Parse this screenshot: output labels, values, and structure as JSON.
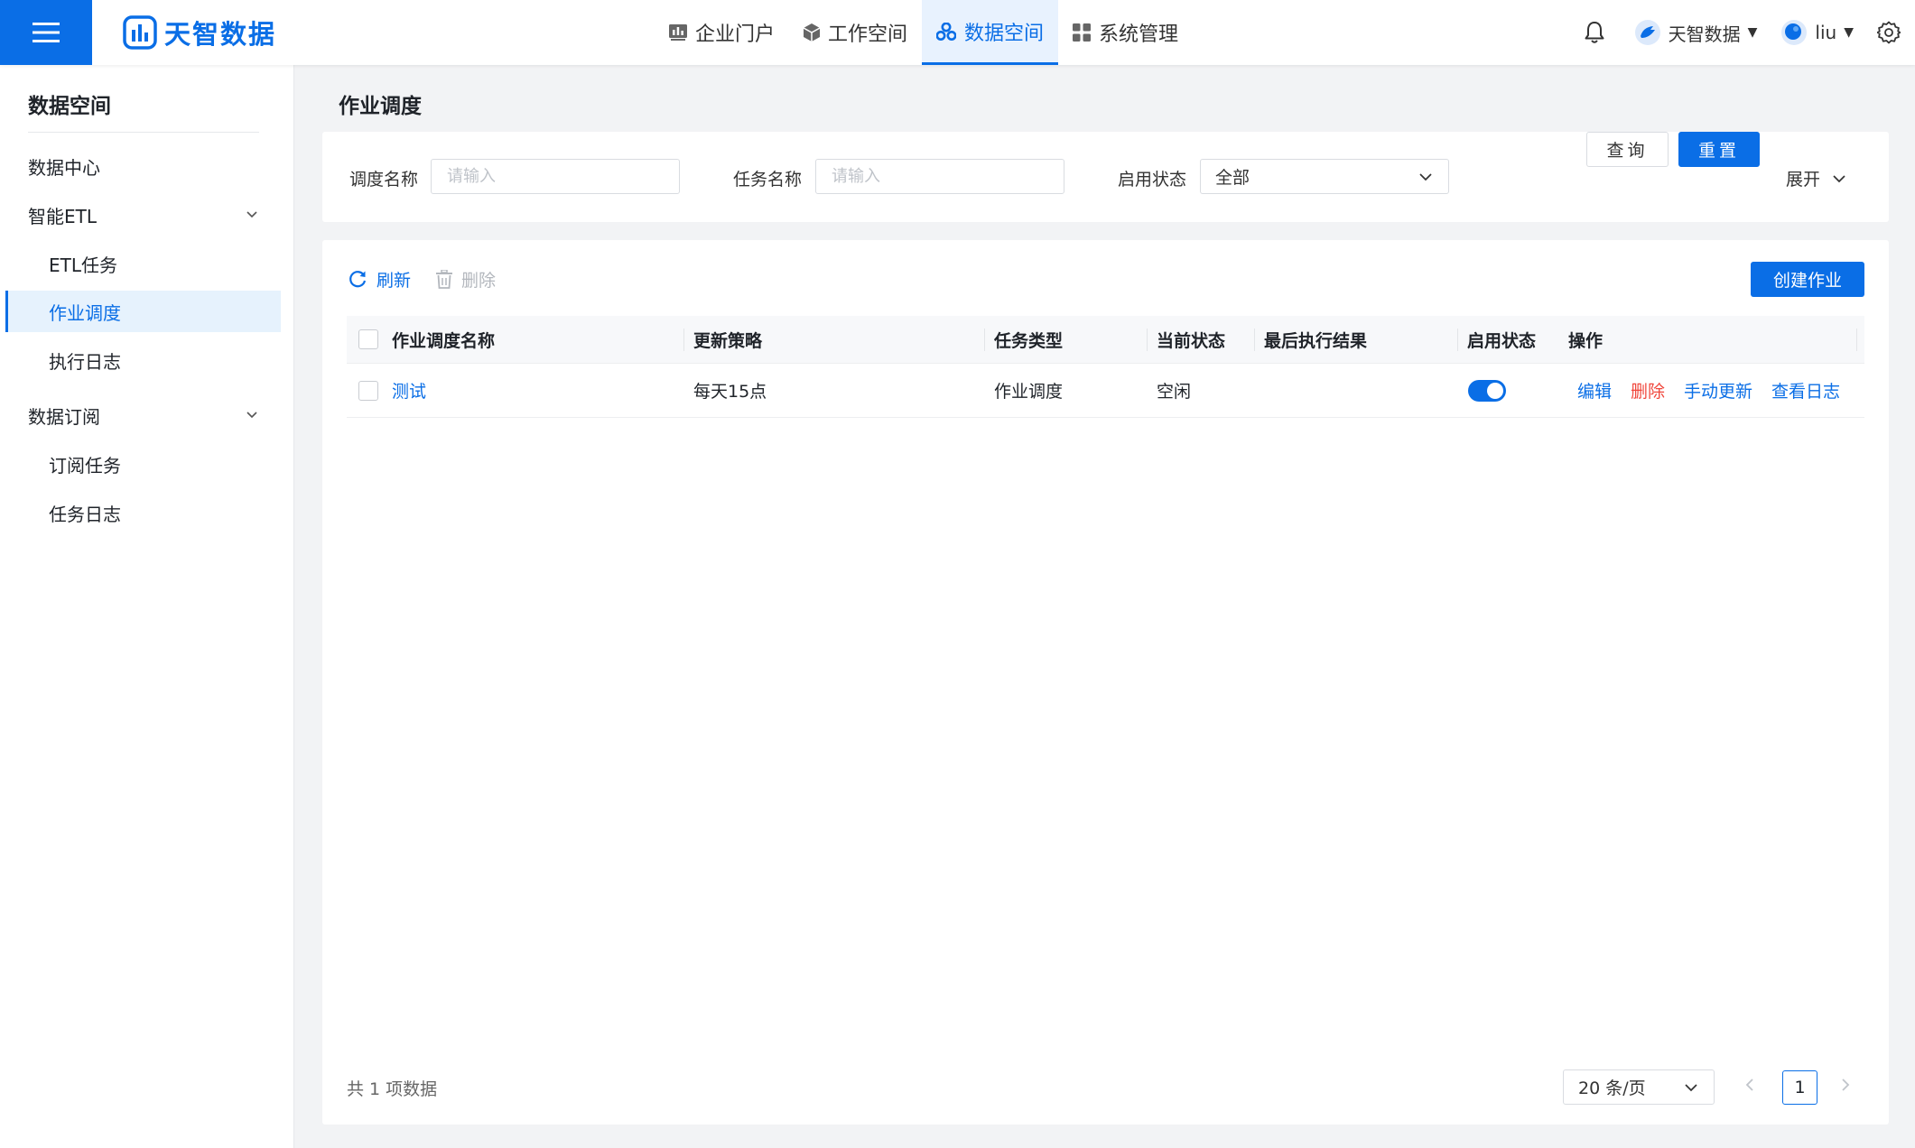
{
  "brand": {
    "name": "天智数据",
    "accent": "#0a6ee6",
    "danger": "#f0473c"
  },
  "topnav": [
    {
      "label": "企业门户",
      "icon": "chart-icon"
    },
    {
      "label": "工作空间",
      "icon": "cube-icon"
    },
    {
      "label": "数据空间",
      "icon": "cluster-icon",
      "active": true
    },
    {
      "label": "系统管理",
      "icon": "grid-icon"
    }
  ],
  "header": {
    "org": "天智数据",
    "user": "liu"
  },
  "sidebar": {
    "title": "数据空间",
    "items": [
      {
        "label": "数据中心"
      },
      {
        "label": "智能ETL"
      },
      {
        "label": "ETL任务"
      },
      {
        "label": "作业调度",
        "active": true
      },
      {
        "label": "执行日志"
      },
      {
        "label": "数据订阅"
      },
      {
        "label": "订阅任务"
      },
      {
        "label": "任务日志"
      }
    ]
  },
  "page": {
    "title": "作业调度"
  },
  "filters": {
    "schedule_name_label": "调度名称",
    "schedule_name_placeholder": "请输入",
    "task_name_label": "任务名称",
    "task_name_placeholder": "请输入",
    "status_label": "启用状态",
    "status_value": "全部",
    "query_label": "查询",
    "reset_label": "重置",
    "expand_label": "展开"
  },
  "toolbar": {
    "refresh_label": "刷新",
    "delete_label": "删除",
    "create_label": "创建作业"
  },
  "table": {
    "columns": [
      "作业调度名称",
      "更新策略",
      "任务类型",
      "当前状态",
      "最后执行结果",
      "启用状态",
      "操作"
    ],
    "rows": [
      {
        "name": "测试",
        "strategy": "每天15点",
        "type": "作业调度",
        "status": "空闲",
        "last_result": "",
        "enabled": true,
        "actions": {
          "edit": "编辑",
          "delete": "删除",
          "manual_update": "手动更新",
          "view_log": "查看日志"
        }
      }
    ]
  },
  "pagination": {
    "total_text": "共 1 项数据",
    "page_size": "20 条/页",
    "current_page": "1"
  }
}
